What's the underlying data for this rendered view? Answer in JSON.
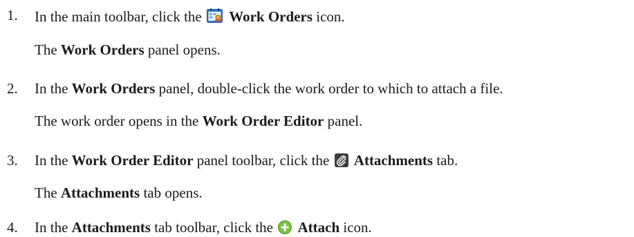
{
  "steps": [
    {
      "number": "1.",
      "pre": "In the main toolbar, click the",
      "icon": "work-orders-icon",
      "bold": "Work Orders",
      "post": "icon.",
      "result_pre": "The",
      "result_bold": "Work Orders",
      "result_post": "panel opens."
    },
    {
      "number": "2.",
      "pre": "In the",
      "bold": "Work Orders",
      "post": "panel, double-click the work order to which to attach a file.",
      "result_pre": "The work order opens in the",
      "result_bold": "Work Order Editor",
      "result_post": "panel."
    },
    {
      "number": "3.",
      "pre": "In the",
      "bold": "Work Order Editor",
      "mid": "panel toolbar, click the",
      "icon": "paperclip-icon",
      "bold2": "Attachments",
      "post": "tab.",
      "result_pre": "The",
      "result_bold": "Attachments",
      "result_post": "tab opens."
    },
    {
      "number": "4.",
      "pre": "In the",
      "bold": "Attachments",
      "mid": "tab toolbar, click the",
      "icon": "attach-plus-icon",
      "bold2": "Attach",
      "post": "icon."
    }
  ],
  "colors": {
    "text": "#1a1a1a",
    "attach_icon_green": "#7cc242",
    "paperclip_bg": "#3d3d3d",
    "work_orders_icon_blue": "#3a78c8"
  }
}
